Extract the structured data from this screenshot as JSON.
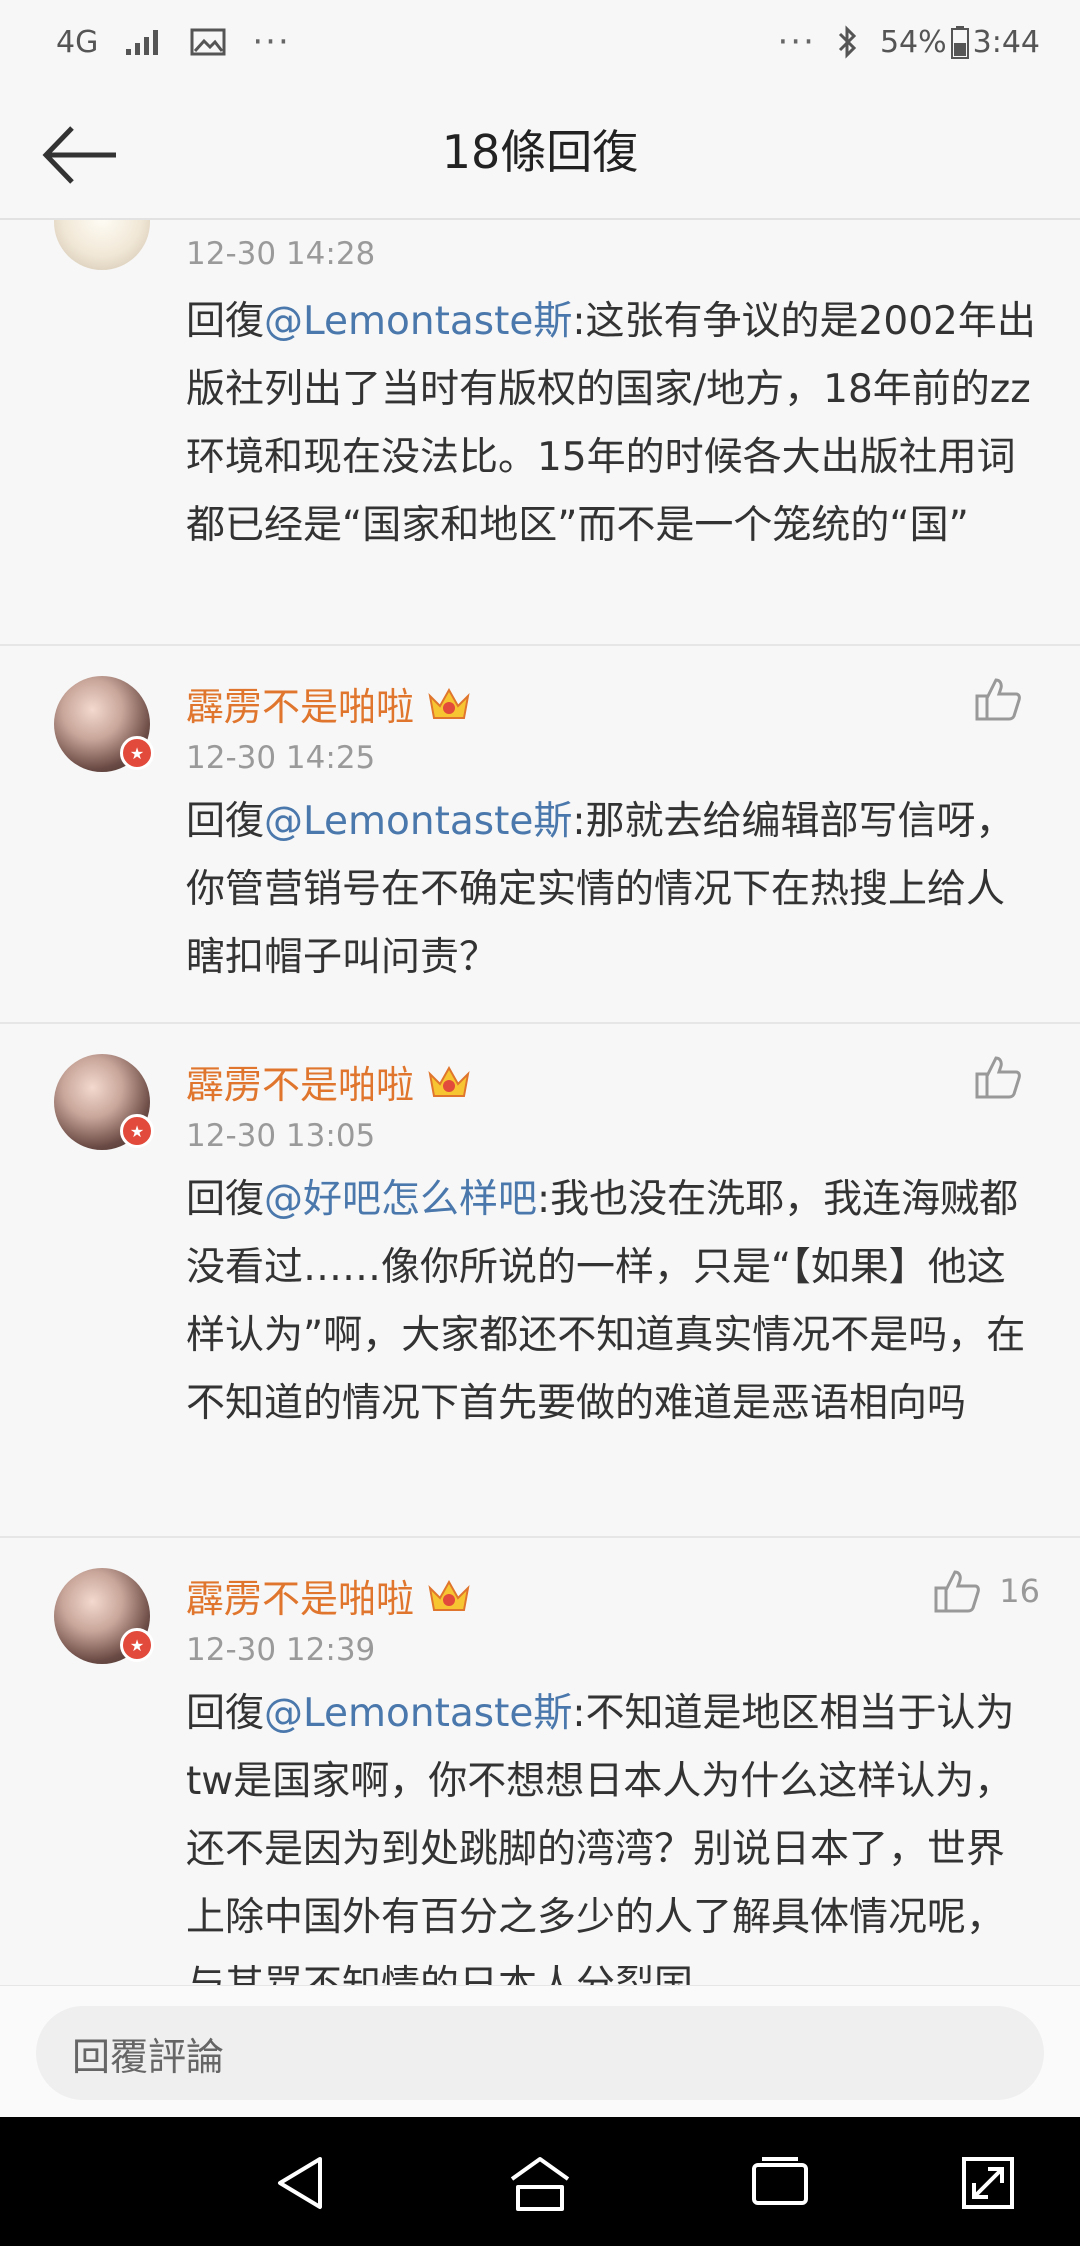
{
  "status_bar": {
    "network": "4G",
    "more_left": "···",
    "more_right": "···",
    "battery_percent": "54%",
    "time": "3:44",
    "icons": [
      "signal-icon",
      "image-icon",
      "bluetooth-icon",
      "battery-icon"
    ]
  },
  "header": {
    "title": "18條回復",
    "back_icon": "back-arrow-icon"
  },
  "comments": [
    {
      "username": "",
      "time": "12-30 14:28",
      "reply_prefix": "回復",
      "mention": "@Lemontaste斯",
      "body": ":这张有争议的是2002年出版社列出了当时有版权的国家/地方，18年前的zz环境和现在没法比。15年的时候各大出版社用词都已经是“国家和地区”而不是一个笼统的“国”",
      "likes": ""
    },
    {
      "username": "霹雳不是啪啦",
      "time": "12-30 14:25",
      "reply_prefix": "回復",
      "mention": "@Lemontaste斯",
      "body": ":那就去给编辑部写信呀，你管营销号在不确定实情的情况下在热搜上给人瞎扣帽子叫问责？",
      "likes": ""
    },
    {
      "username": "霹雳不是啪啦",
      "time": "12-30 13:05",
      "reply_prefix": "回復",
      "mention": "@好吧怎么样吧",
      "body": ":我也没在洗耶，我连海贼都没看过……像你所说的一样，只是“【如果】他这样认为”啊，大家都还不知道真实情况不是吗，在不知道的情况下首先要做的难道是恶语相向吗",
      "likes": ""
    },
    {
      "username": "霹雳不是啪啦",
      "time": "12-30 12:39",
      "reply_prefix": "回復",
      "mention": "@Lemontaste斯",
      "body": ":不知道是地区相当于认为tw是国家啊，你不想想日本人为什么这样认为，还不是因为到处跳脚的湾湾？别说日本了，世界上除中国外有百分之多少的人了解具体情况呢，与其骂不知情的日本人分裂国",
      "likes": "16"
    }
  ],
  "reply_bar": {
    "placeholder": "回覆評論"
  },
  "colors": {
    "username": "#e0762d",
    "mention": "#4a78ac",
    "time": "#9a9a9a"
  }
}
